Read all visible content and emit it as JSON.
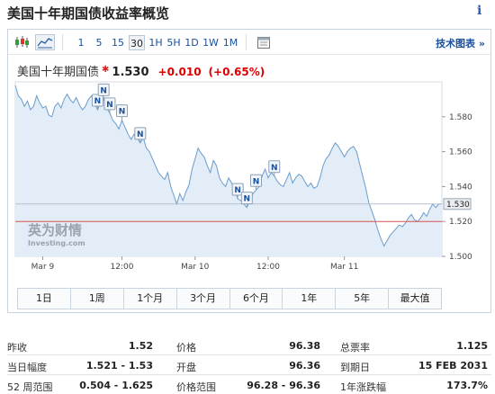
{
  "page": {
    "title": "美国十年期国债收益率概览",
    "info_glyph": "i"
  },
  "toolbar": {
    "icons": [
      "candlestick-icon",
      "area-chart-icon",
      "calendar-icon"
    ],
    "timeframes": [
      "1",
      "5",
      "15",
      "30",
      "1H",
      "5H",
      "1D",
      "1W",
      "1M"
    ],
    "active_timeframe": "30",
    "tech_chart_link": "技术图表 »"
  },
  "quote": {
    "name": "美国十年期国债",
    "price": "1.530",
    "change": "+0.010",
    "change_pct": "(+0.65%)",
    "up_color": "#d00000"
  },
  "chart": {
    "x_labels": [
      "Mar 9",
      "12:00",
      "Mar 10",
      "12:00",
      "Mar 11"
    ],
    "y_ticks": [
      "1.580",
      "1.560",
      "1.540",
      "1.520",
      "1.500"
    ],
    "current_label": "1.530",
    "prev_close_line": "1.52",
    "news_marker": "N",
    "watermark_cn": "英为财情",
    "watermark_en": "Investing.com",
    "line_color": "#6b9ccd",
    "fill_color": "#e3edf7",
    "ref_line_color": "#d9534f"
  },
  "chart_data": {
    "type": "area",
    "title": "美国十年期国债",
    "ylim": [
      1.5,
      1.6
    ],
    "x": [
      0,
      1,
      2,
      3,
      4,
      5,
      6,
      7,
      8,
      9,
      10,
      11,
      12,
      13,
      14,
      15,
      16,
      17,
      18,
      19,
      20,
      21,
      22,
      23,
      24,
      25,
      26,
      27,
      28,
      29,
      30,
      31,
      32,
      33,
      34,
      35,
      36,
      37,
      38,
      39,
      40,
      41,
      42,
      43,
      44,
      45,
      46,
      47,
      48,
      49,
      50,
      51,
      52,
      53,
      54,
      55,
      56,
      57,
      58,
      59,
      60,
      61,
      62,
      63,
      64,
      65,
      66,
      67,
      68,
      69,
      70,
      71,
      72,
      73,
      74,
      75,
      76,
      77,
      78,
      79,
      80,
      81,
      82,
      83,
      84,
      85,
      86,
      87,
      88,
      89,
      90,
      91,
      92,
      93,
      94,
      95,
      96,
      97,
      98,
      99,
      100,
      101,
      102,
      103,
      104,
      105,
      106,
      107,
      108,
      109,
      110,
      111,
      112,
      113,
      114,
      115,
      116,
      117,
      118,
      119,
      120,
      121,
      122,
      123,
      124,
      125,
      126,
      127,
      128,
      129,
      130,
      131,
      132,
      133,
      134,
      135,
      136,
      137,
      138,
      139,
      140
    ],
    "values": [
      1.598,
      1.592,
      1.59,
      1.586,
      1.589,
      1.584,
      1.586,
      1.592,
      1.588,
      1.585,
      1.586,
      1.581,
      1.58,
      1.586,
      1.588,
      1.585,
      1.59,
      1.593,
      1.59,
      1.588,
      1.591,
      1.587,
      1.584,
      1.586,
      1.59,
      1.592,
      1.588,
      1.584,
      1.588,
      1.59,
      1.585,
      1.582,
      1.578,
      1.576,
      1.573,
      1.578,
      1.574,
      1.57,
      1.567,
      1.57,
      1.568,
      1.565,
      1.568,
      1.562,
      1.56,
      1.556,
      1.552,
      1.548,
      1.546,
      1.544,
      1.548,
      1.54,
      1.535,
      1.53,
      1.536,
      1.532,
      1.537,
      1.541,
      1.55,
      1.556,
      1.562,
      1.559,
      1.557,
      1.552,
      1.548,
      1.555,
      1.552,
      1.545,
      1.542,
      1.54,
      1.545,
      1.542,
      1.538,
      1.533,
      1.532,
      1.53,
      1.528,
      1.532,
      1.536,
      1.538,
      1.54,
      1.546,
      1.55,
      1.545,
      1.548,
      1.546,
      1.543,
      1.541,
      1.54,
      1.544,
      1.548,
      1.542,
      1.545,
      1.547,
      1.546,
      1.543,
      1.54,
      1.542,
      1.539,
      1.54,
      1.545,
      1.552,
      1.556,
      1.558,
      1.562,
      1.565,
      1.563,
      1.56,
      1.557,
      1.56,
      1.562,
      1.563,
      1.56,
      1.553,
      1.546,
      1.539,
      1.531,
      1.526,
      1.521,
      1.515,
      1.51,
      1.506,
      1.509,
      1.512,
      1.514,
      1.516,
      1.518,
      1.517,
      1.519,
      1.522,
      1.524,
      1.521,
      1.52,
      1.522,
      1.525,
      1.523,
      1.527,
      1.53,
      1.528,
      1.53,
      1.53
    ],
    "x_tick_positions": [
      9,
      35,
      59,
      83,
      108
    ],
    "reference_value": 1.52,
    "news_markers_x": [
      27,
      29,
      31,
      35,
      41,
      73,
      76,
      79,
      85
    ]
  },
  "range_buttons": [
    "1日",
    "1周",
    "1个月",
    "3个月",
    "6个月",
    "1年",
    "5年",
    "最大值"
  ],
  "stats": {
    "col1": [
      {
        "label": "昨收",
        "value": "1.52"
      },
      {
        "label": "当日幅度",
        "value": "1.521 - 1.53"
      },
      {
        "label": "52 周范围",
        "value": "0.504 - 1.625"
      }
    ],
    "col2": [
      {
        "label": "价格",
        "value": "96.38"
      },
      {
        "label": "开盘",
        "value": "96.36"
      },
      {
        "label": "价格范围",
        "value": "96.28 - 96.36"
      }
    ],
    "col3": [
      {
        "label": "总票率",
        "value": "1.125"
      },
      {
        "label": "到期日",
        "value": "15 FEB 2031"
      },
      {
        "label": "1年涨跌幅",
        "value": "173.7%"
      }
    ]
  }
}
